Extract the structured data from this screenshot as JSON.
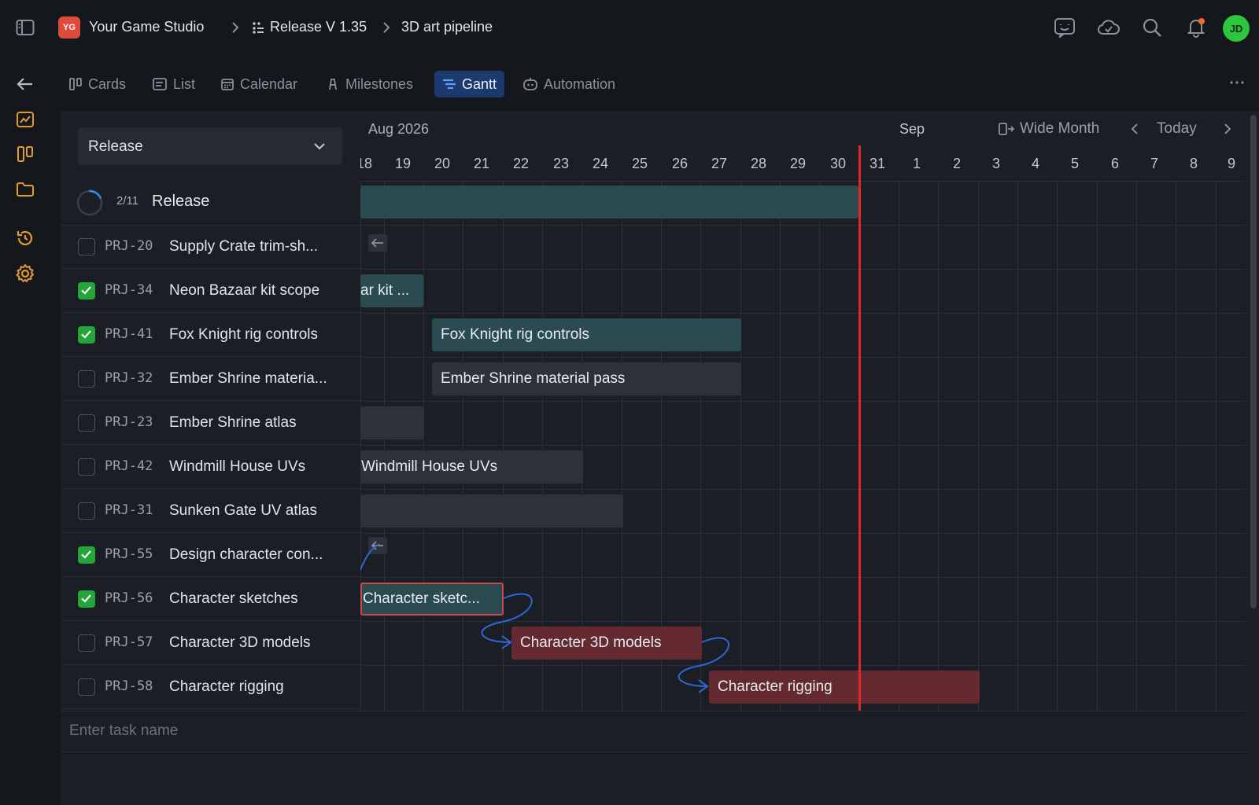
{
  "topbar": {
    "studio_badge": "YG",
    "studio_name": "Your Game Studio",
    "release_crumb": "Release V 1.35",
    "pipeline_crumb": "3D art pipeline",
    "avatar_initials": "JD"
  },
  "tabs": [
    {
      "label": "Cards",
      "icon": "cards-icon",
      "active": false
    },
    {
      "label": "List",
      "icon": "list-icon",
      "active": false
    },
    {
      "label": "Calendar",
      "icon": "calendar-icon",
      "active": false
    },
    {
      "label": "Milestones",
      "icon": "milestone-icon",
      "active": false
    },
    {
      "label": "Gantt",
      "icon": "gantt-icon",
      "active": true
    },
    {
      "label": "Automation",
      "icon": "automation-icon",
      "active": false
    }
  ],
  "grouping": {
    "selected": "Release"
  },
  "release_group": {
    "progress": "2/11",
    "progress_fraction": 0.18,
    "name": "Release"
  },
  "tasks": [
    {
      "code": "PRJ-20",
      "title": "Supply Crate trim-sh...",
      "done": false
    },
    {
      "code": "PRJ-34",
      "title": "Neon Bazaar kit scope",
      "done": true
    },
    {
      "code": "PRJ-41",
      "title": "Fox Knight rig controls",
      "done": true
    },
    {
      "code": "PRJ-32",
      "title": "Ember Shrine materia...",
      "done": false
    },
    {
      "code": "PRJ-23",
      "title": "Ember Shrine atlas",
      "done": false
    },
    {
      "code": "PRJ-42",
      "title": "Windmill House UVs",
      "done": false
    },
    {
      "code": "PRJ-31",
      "title": "Sunken Gate UV atlas",
      "done": false
    },
    {
      "code": "PRJ-55",
      "title": "Design character con...",
      "done": true
    },
    {
      "code": "PRJ-56",
      "title": "Character sketches",
      "done": true
    },
    {
      "code": "PRJ-57",
      "title": "Character 3D models",
      "done": false
    },
    {
      "code": "PRJ-58",
      "title": "Character rigging",
      "done": false
    }
  ],
  "timeline": {
    "month_label": "Aug 2026",
    "next_month_label": "Sep",
    "scale_label": "Wide Month",
    "today_label": "Today",
    "days": [
      "18",
      "19",
      "20",
      "21",
      "22",
      "23",
      "24",
      "25",
      "26",
      "27",
      "28",
      "29",
      "30",
      "31",
      "1",
      "2",
      "3",
      "4",
      "5",
      "6",
      "7",
      "8",
      "9"
    ]
  },
  "bars": {
    "neon": "ar kit ...",
    "fox": "Fox Knight rig controls",
    "ember": "Ember Shrine material pass",
    "windmill": "Windmill House UVs",
    "sketches": "Character sketc...",
    "models": "Character 3D models",
    "rigging": "Character rigging"
  },
  "new_task": {
    "placeholder": "Enter task name"
  },
  "colors": {
    "accent": "#1c3a6e",
    "today_line": "#e4262b",
    "done_check": "#22a63a",
    "studio_badge": "#e04a3a",
    "avatar": "#2ec63e"
  }
}
